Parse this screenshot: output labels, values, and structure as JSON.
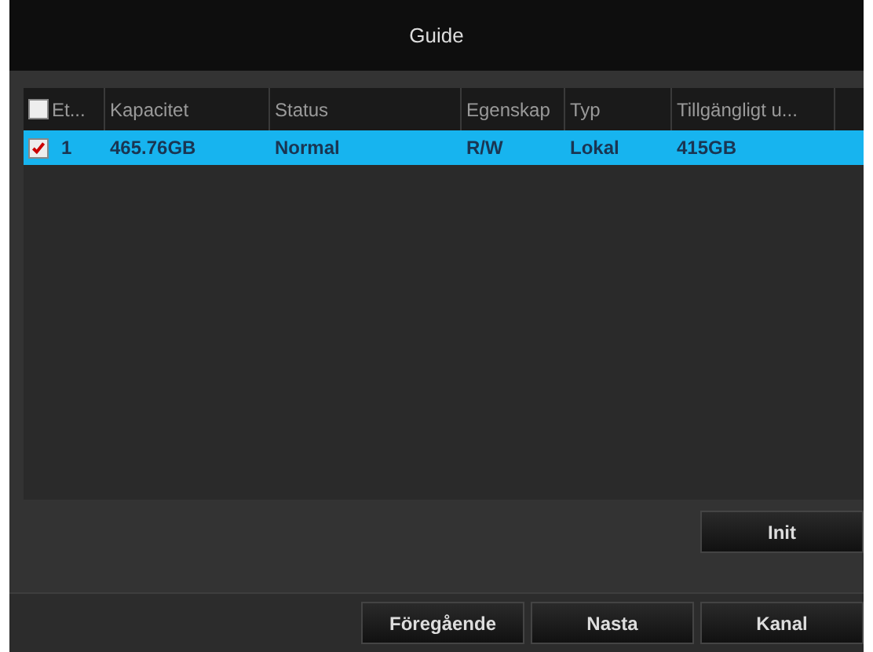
{
  "window": {
    "title": "Guide"
  },
  "table": {
    "header_checkbox": {
      "checked": false
    },
    "columns": [
      "Et...",
      "Kapacitet",
      "Status",
      "Egenskap",
      "Typ",
      "Tillgängligt u..."
    ],
    "rows": [
      {
        "checked": true,
        "selected": true,
        "cells": [
          "1",
          "465.76GB",
          "Normal",
          "R/W",
          "Lokal",
          "415GB"
        ]
      }
    ]
  },
  "init_button": "Init",
  "buttons": [
    "Föregående",
    "Nasta",
    "Kanal"
  ]
}
